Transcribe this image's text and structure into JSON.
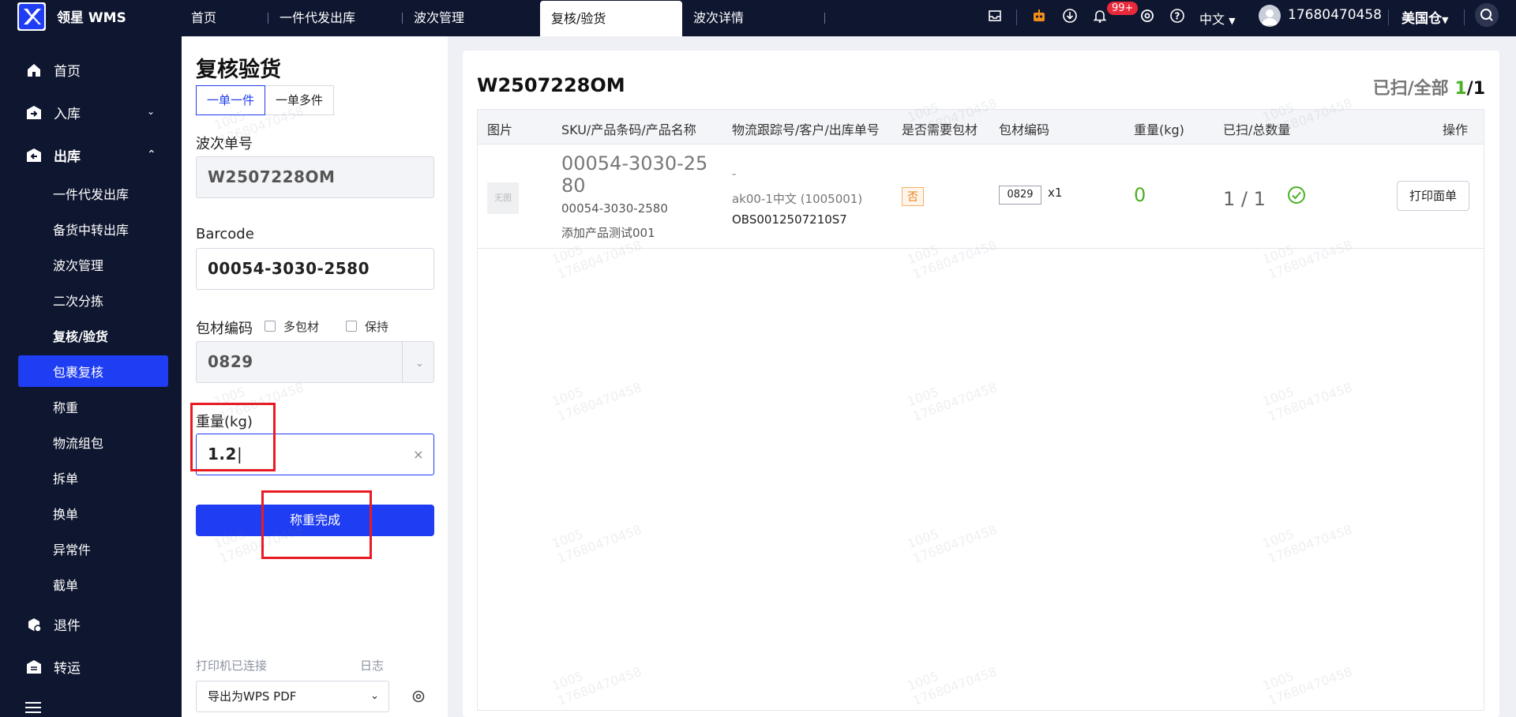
{
  "app": {
    "brand": "领星 WMS"
  },
  "top_tabs": [
    {
      "label": "首页"
    },
    {
      "label": "一件代发出库"
    },
    {
      "label": "波次管理"
    },
    {
      "label": "复核/验货"
    },
    {
      "label": "波次详情"
    }
  ],
  "header": {
    "notif_badge": "99+",
    "language": "中文",
    "user_phone": "17680470458",
    "warehouse": "美国仓"
  },
  "sidebar": {
    "home": "首页",
    "inbound": "入库",
    "outbound": "出库",
    "sub": [
      "一件代发出库",
      "备货中转出库",
      "波次管理",
      "二次分拣",
      "复核/验货",
      "包裹复核",
      "称重",
      "物流组包",
      "拆单",
      "换单",
      "异常件",
      "截单"
    ],
    "returns": "退件",
    "transfer": "转运"
  },
  "left": {
    "title": "复核验货",
    "mode_single": "一单一件",
    "mode_multi": "一单多件",
    "wave_label": "波次单号",
    "wave_value": "W2507228OM",
    "barcode_label": "Barcode",
    "barcode_value": "00054-3030-2580",
    "pkg_label": "包材编码",
    "multi_pkg": "多包材",
    "keep": "保持",
    "pkg_value": "0829",
    "weight_label": "重量(kg)",
    "weight_value": "1.2",
    "confirm_btn": "称重完成",
    "printer_status": "打印机已连接",
    "log": "日志",
    "printer_select": "导出为WPS PDF"
  },
  "main": {
    "order_no": "W2507228OM",
    "scan_prefix": "已扫/全部",
    "scan_done": "1",
    "scan_sep": "/",
    "scan_total": "1",
    "columns": [
      "图片",
      "SKU/产品条码/产品名称",
      "物流跟踪号/客户/出库单号",
      "是否需要包材",
      "包材编码",
      "重量(kg)",
      "已扫/总数量",
      "操作"
    ],
    "row": {
      "no_image": "无图",
      "sku_big_1": "00054-3030-25",
      "sku_big_2": "80",
      "sku_small": "00054-3030-2580",
      "product_name": "添加产品测试001",
      "tracking": "-",
      "customer": "ak00-1中文 (1005001)",
      "outbound_no": "OBS0012507210S7",
      "need_pkg": "否",
      "pkg_code": "0829",
      "pkg_qty": "x1",
      "weight": "0",
      "scanned": "1 / 1",
      "action": "打印面单"
    }
  },
  "watermark": {
    "line1": "1005",
    "line2": "17680470458"
  },
  "colors": {
    "accent": "#1f3df2",
    "nav_bg": "#0f1730",
    "success": "#4caf26",
    "highlight": "#e81b23"
  }
}
